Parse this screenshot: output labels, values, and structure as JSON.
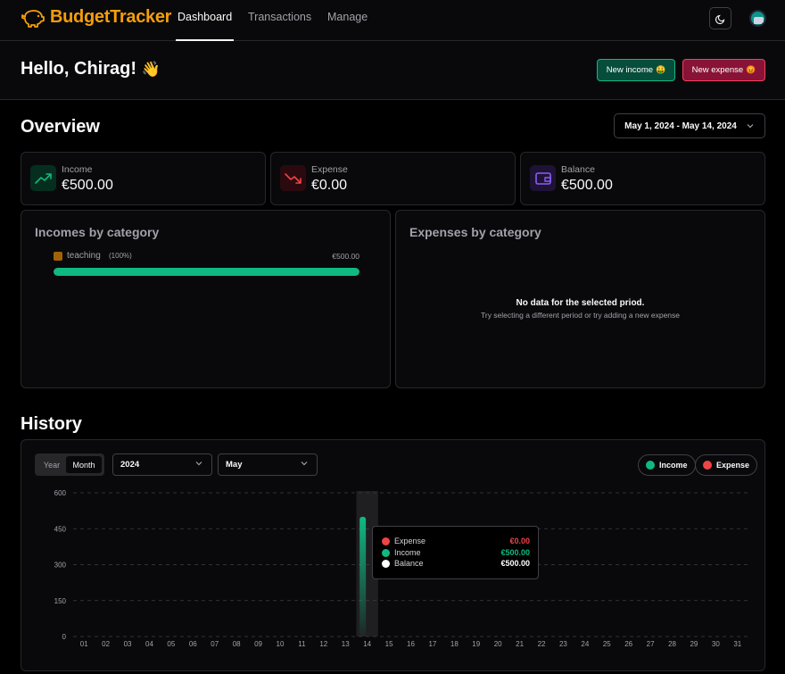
{
  "header": {
    "app_name": "BudgetTracker",
    "nav": [
      {
        "label": "Dashboard",
        "active": true
      },
      {
        "label": "Transactions",
        "active": false
      },
      {
        "label": "Manage",
        "active": false
      }
    ],
    "theme_icon": "moon-icon",
    "avatar_icon": "user-avatar-icon"
  },
  "greeting": {
    "text": "Hello, Chirag!",
    "emoji": "👋",
    "new_income_label": "New income",
    "new_income_emoji": "🤑",
    "new_expense_label": "New expense",
    "new_expense_emoji": "😡"
  },
  "overview": {
    "title": "Overview",
    "date_range": "May 1, 2024 - May 14, 2024",
    "stats": [
      {
        "label": "Income",
        "value": "€500.00",
        "icon": "trending-up-icon",
        "color": "#10b981"
      },
      {
        "label": "Expense",
        "value": "€0.00",
        "icon": "trending-down-icon",
        "color": "#ef4444"
      },
      {
        "label": "Balance",
        "value": "€500.00",
        "icon": "wallet-icon",
        "color": "#8b5cf6"
      }
    ]
  },
  "incomes_by_category": {
    "title": "Incomes by category",
    "items": [
      {
        "emoji": "🏅",
        "name": "teaching",
        "percent_label": "(100%)",
        "amount": "€500.00",
        "percent": 100
      }
    ]
  },
  "expenses_by_category": {
    "title": "Expenses by category",
    "empty_title": "No data for the selected priod.",
    "empty_subtitle": "Try selecting a different period or try adding a new expense"
  },
  "history": {
    "title": "History",
    "timeframe_options": [
      "Year",
      "Month"
    ],
    "selected_timeframe": "Month",
    "year": "2024",
    "month": "May",
    "legend": [
      {
        "label": "Income",
        "color": "#10b981"
      },
      {
        "label": "Expense",
        "color": "#ef4444"
      }
    ],
    "tooltip": {
      "rows": [
        {
          "label": "Expense",
          "value": "€0.00",
          "color": "#ef4444"
        },
        {
          "label": "Income",
          "value": "€500.00",
          "color": "#10b981"
        },
        {
          "label": "Balance",
          "value": "€500.00",
          "color": "#ffffff"
        }
      ]
    }
  },
  "chart_data": {
    "type": "bar",
    "categories": [
      "01",
      "02",
      "03",
      "04",
      "05",
      "06",
      "07",
      "08",
      "09",
      "10",
      "11",
      "12",
      "13",
      "14",
      "15",
      "16",
      "17",
      "18",
      "19",
      "20",
      "21",
      "22",
      "23",
      "24",
      "25",
      "26",
      "27",
      "28",
      "29",
      "30",
      "31"
    ],
    "series": [
      {
        "name": "Income",
        "values": [
          0,
          0,
          0,
          0,
          0,
          0,
          0,
          0,
          0,
          0,
          0,
          0,
          0,
          500,
          0,
          0,
          0,
          0,
          0,
          0,
          0,
          0,
          0,
          0,
          0,
          0,
          0,
          0,
          0,
          0,
          0
        ]
      },
      {
        "name": "Expense",
        "values": [
          0,
          0,
          0,
          0,
          0,
          0,
          0,
          0,
          0,
          0,
          0,
          0,
          0,
          0,
          0,
          0,
          0,
          0,
          0,
          0,
          0,
          0,
          0,
          0,
          0,
          0,
          0,
          0,
          0,
          0,
          0
        ]
      }
    ],
    "yticks": [
      0,
      150,
      300,
      450,
      600
    ],
    "ylim": [
      0,
      600
    ],
    "highlighted_category": "14",
    "grid": true
  }
}
